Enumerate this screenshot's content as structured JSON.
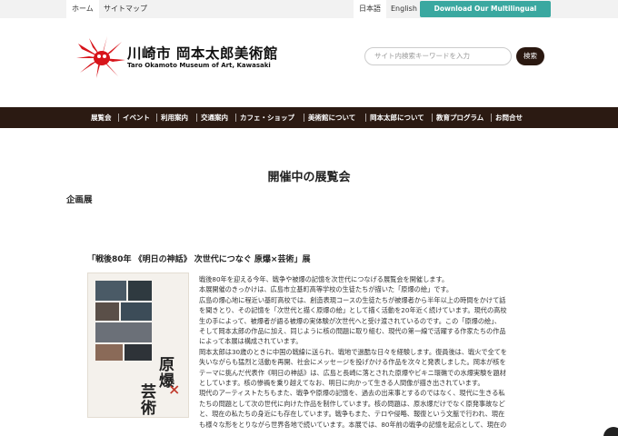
{
  "topbar": {
    "home": "ホーム",
    "sitemap": "サイトマップ",
    "lang_ja": "日本語",
    "lang_en": "English",
    "brochure": "Download Our Multilingual Brochures"
  },
  "header": {
    "title": "川崎市 岡本太郎美術館",
    "subtitle": "Taro Okamoto Museum of Art, Kawasaki",
    "search_placeholder": "サイト内検索キーワードを入力",
    "search_button": "検索"
  },
  "nav": {
    "items": [
      "展覧会",
      "イベント",
      "利用案内",
      "交通案内",
      "カフェ・ショップ",
      "美術館について",
      "岡本太郎について",
      "教育プログラム",
      "お問合せ"
    ]
  },
  "main": {
    "heading": "開催中の展覧会",
    "section": "企画展",
    "exhibit_title": "「戦後80年 《明日の神話》 次世代につなぐ 原爆×芸術」展",
    "poster_text_1": "原爆",
    "poster_text_2": "芸術",
    "poster_cross": "×",
    "body_lines": [
      "戦後80年を迎える今年、戦争や被爆の記憶を次世代につなげる展覧会を開催します。",
      "本展開催のきっかけは、広島市立基町高等学校の生徒たちが描いた「原爆の絵」です。",
      "広島の爆心地に程近い基町高校では、創造表現コースの生徒たちが被爆者から半年以上の時間をかけて話",
      "を聞きとり、その記憶を「次世代と描く原爆の絵」として描く活動を20年近く続けています。現代の高校",
      "生の手によって、被爆者が語る被爆の実体験が次世代へと受け渡されているのです。この「原爆の絵」、",
      "そして岡本太郎の作品に加え、同じように核の問題に取り組む、現代の第一線で活躍する作家たちの作品",
      "によって本展は構成されています。",
      "岡本太郎は30歳のときに中国の戦線に送られ、戦地で過酷な日々を経験します。復員後は、戦火で全てを",
      "失いながらも猛烈と活動を再開、社会にメッセージを投げかける作品を次々と発表しました。岡本が核を",
      "テーマに挑んだ代表作《明日の神話》は、広島と長崎に落とされた原爆やビキニ環礁での水爆実験を題材",
      "としています。核の惨禍を乗り越えてなお、明日に向かって生きる人間像が描き出されています。",
      "現代のアーティストたちもまた、戦争や原爆の記憶を、過去の出来事とするのではなく、現代に生きる私",
      "たちの問題として次の世代に向けた作品を制作しています。核の問題は、原水爆だけでなく原発事故など",
      "と、現在の私たちの身近にも存在しています。戦争もまた、テロや侵略、報復という文脈で行われ、現在",
      "も様々な形をとりながら世界各地で続いています。本展では、80年前の戦争の記憶を起点として、現在の"
    ]
  },
  "colors": {
    "nav_bg": "#2b1a12",
    "brochure_bg": "#3aa8a0",
    "logo_red": "#d7141a"
  }
}
